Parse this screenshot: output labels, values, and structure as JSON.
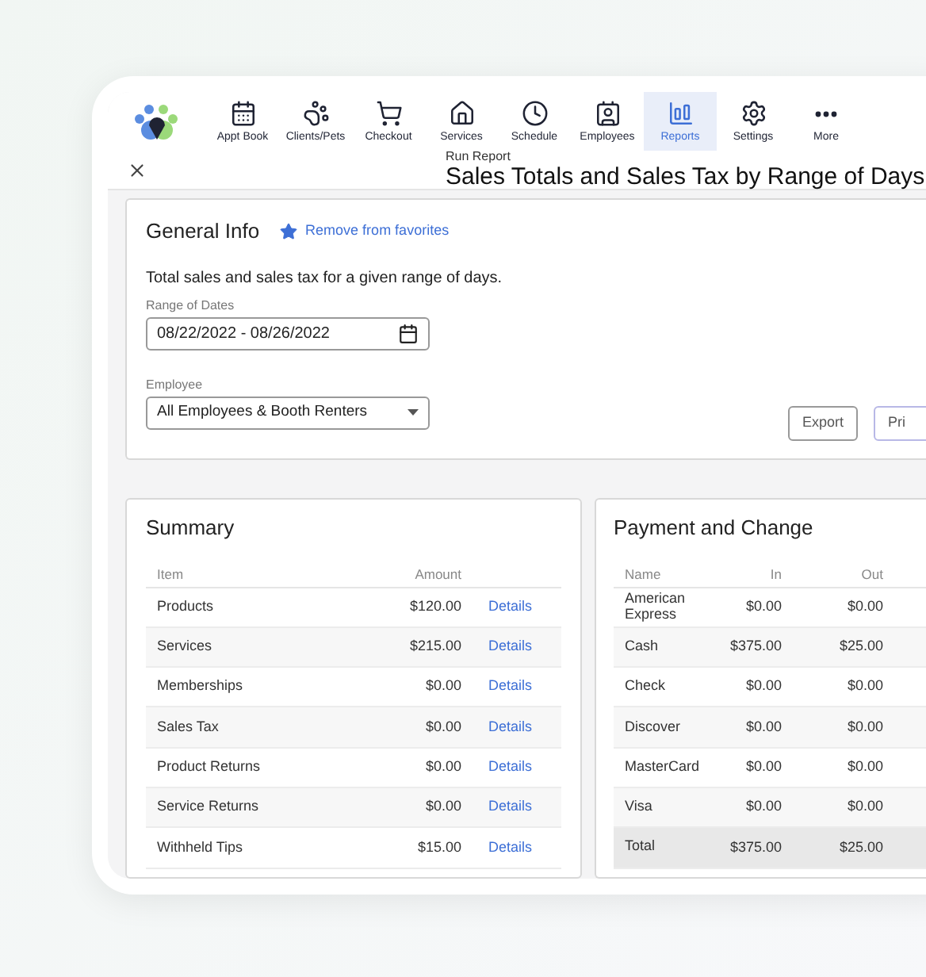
{
  "nav": {
    "items": [
      {
        "label": "Appt Book",
        "selected": false
      },
      {
        "label": "Clients/Pets",
        "selected": false
      },
      {
        "label": "Checkout",
        "selected": false
      },
      {
        "label": "Services",
        "selected": false
      },
      {
        "label": "Schedule",
        "selected": false
      },
      {
        "label": "Employees",
        "selected": false
      },
      {
        "label": "Reports",
        "selected": true
      },
      {
        "label": "Settings",
        "selected": false
      },
      {
        "label": "More",
        "selected": false
      }
    ]
  },
  "header": {
    "subtitle": "Run Report",
    "title": "Sales Totals and Sales Tax by Range of Days"
  },
  "general_info": {
    "title": "General Info",
    "favorite_link": "Remove from favorites",
    "description": "Total sales and sales tax for a given range of days.",
    "date_range": {
      "label": "Range of Dates",
      "value": "08/22/2022 - 08/26/2022"
    },
    "employee": {
      "label": "Employee",
      "value": "All Employees & Booth Renters"
    },
    "buttons": [
      "Export",
      "Pri"
    ]
  },
  "summary": {
    "title": "Summary",
    "columns": [
      "Item",
      "Amount"
    ],
    "rows": [
      {
        "item": "Products",
        "amount": "$120.00",
        "link": "Details"
      },
      {
        "item": "Services",
        "amount": "$215.00",
        "link": "Details"
      },
      {
        "item": "Memberships",
        "amount": "$0.00",
        "link": "Details"
      },
      {
        "item": "Sales Tax",
        "amount": "$0.00",
        "link": "Details"
      },
      {
        "item": "Product Returns",
        "amount": "$0.00",
        "link": "Details"
      },
      {
        "item": "Service Returns",
        "amount": "$0.00",
        "link": "Details"
      },
      {
        "item": "Withheld Tips",
        "amount": "$15.00",
        "link": "Details"
      }
    ]
  },
  "payment": {
    "title": "Payment and Change",
    "columns": [
      "Name",
      "In",
      "Out"
    ],
    "rows": [
      {
        "kind": "row",
        "name": "American Express",
        "in": "$0.00",
        "out": "$0.00"
      },
      {
        "kind": "row",
        "name": "Cash",
        "in": "$375.00",
        "out": "$25.00"
      },
      {
        "kind": "row",
        "name": "Check",
        "in": "$0.00",
        "out": "$0.00"
      },
      {
        "kind": "row",
        "name": "Discover",
        "in": "$0.00",
        "out": "$0.00"
      },
      {
        "kind": "row",
        "name": "MasterCard",
        "in": "$0.00",
        "out": "$0.00"
      },
      {
        "kind": "row",
        "name": "Visa",
        "in": "$0.00",
        "out": "$0.00"
      },
      {
        "kind": "total",
        "name": "Total",
        "in": "$375.00",
        "out": "$25.00"
      }
    ]
  }
}
